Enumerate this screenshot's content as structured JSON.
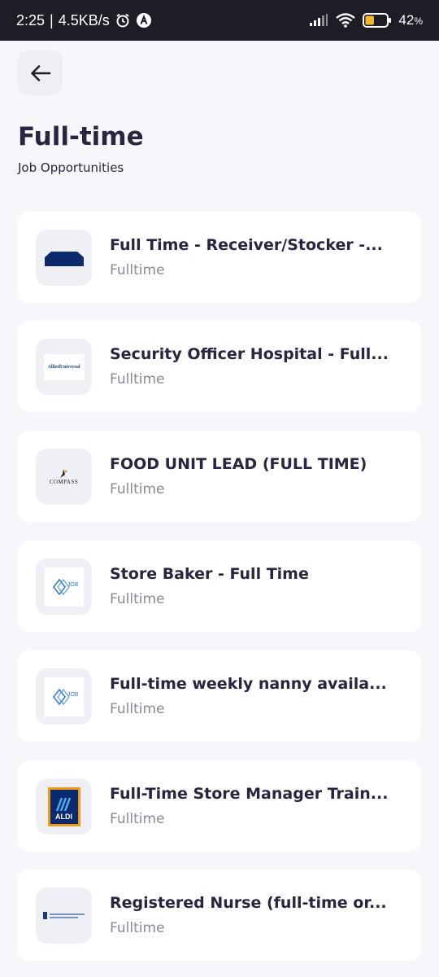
{
  "status_bar": {
    "time": "2:25",
    "network_speed": "4.5KB/s",
    "battery": "42",
    "battery_unit": "%",
    "battery_level": 0.42,
    "icons": [
      "alarm-icon",
      "a-notification-icon",
      "signal-icon",
      "wifi-icon",
      "battery-icon"
    ]
  },
  "header": {
    "back_icon": "arrow-left-icon",
    "title": "Full-time",
    "subtitle": "Job Opportunities"
  },
  "jobs": [
    {
      "title": "Full Time - Receiver/Stocker -...",
      "type": "Fulltime",
      "logo": "navy-roof-logo"
    },
    {
      "title": "Security Officer Hospital - Full...",
      "type": "Fulltime",
      "logo": "allied-universal-logo",
      "logo_text": "AlliedUniversal"
    },
    {
      "title": "FOOD UNIT LEAD (FULL TIME)",
      "type": "Fulltime",
      "logo": "compass-logo",
      "logo_text": "COMPASS"
    },
    {
      "title": "Store Baker - Full Time",
      "type": "Fulltime",
      "logo": "job-logo",
      "logo_text": "JOB"
    },
    {
      "title": "Full-time weekly nanny availa...",
      "type": "Fulltime",
      "logo": "job-logo",
      "logo_text": "JOB"
    },
    {
      "title": "Full-Time Store Manager Train...",
      "type": "Fulltime",
      "logo": "aldi-logo",
      "logo_text": "ALDI"
    },
    {
      "title": "Registered Nurse (full-time or...",
      "type": "Fulltime",
      "logo": "healthcare-logo"
    }
  ],
  "colors": {
    "background": "#f7f7fb",
    "status_bar": "#1d1d25",
    "title_text": "#2a2440",
    "muted_text": "#8a8a96",
    "card": "#ffffff",
    "logo_bg": "#eef0f5",
    "battery_fill": "#f0b72f"
  }
}
